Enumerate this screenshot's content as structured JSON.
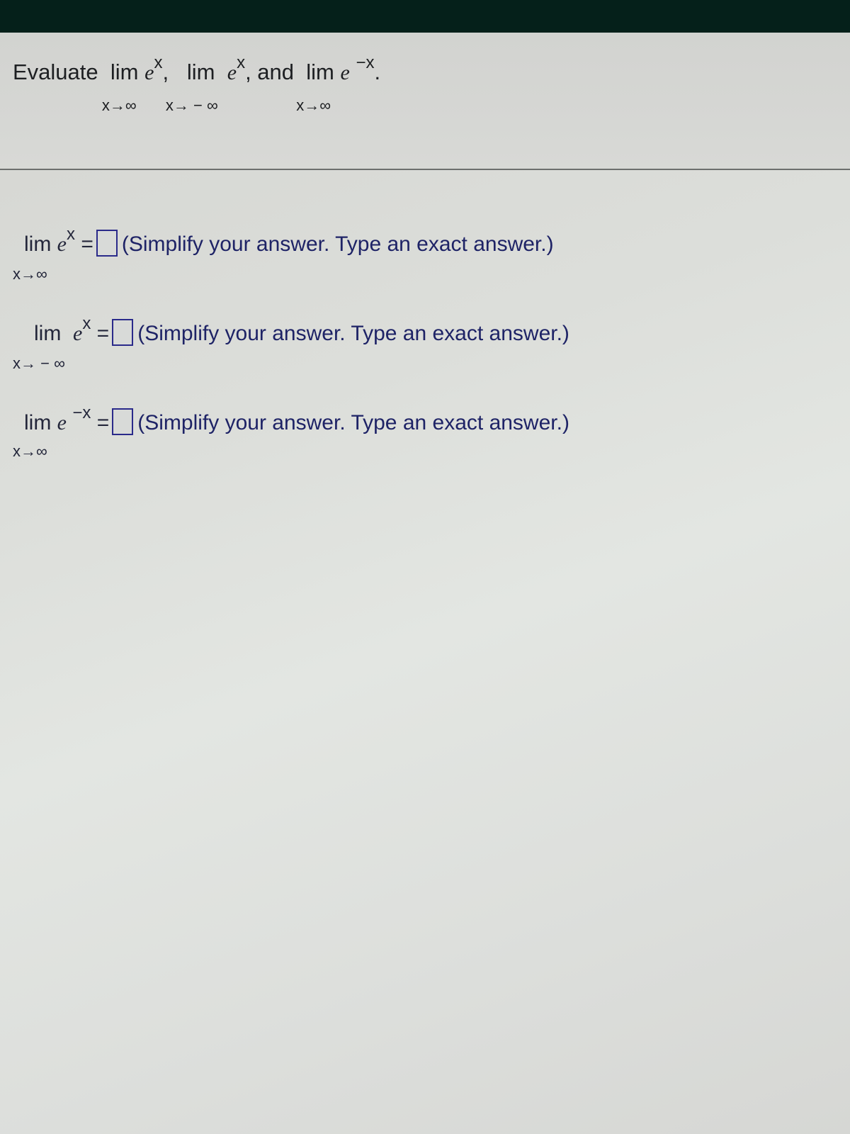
{
  "question": {
    "evaluate_label": "Evaluate",
    "lim_word": "lim",
    "items": [
      {
        "base": "e",
        "exponent": "x",
        "approach": "x→∞",
        "separator": ","
      },
      {
        "base": "e",
        "exponent": "x",
        "approach": "x→ − ∞",
        "separator": ", and"
      },
      {
        "base": "e",
        "exponent": "−x",
        "approach": "x→∞",
        "separator": "."
      }
    ]
  },
  "answers": [
    {
      "lim_word": "lim",
      "base": "e",
      "exponent": "x",
      "approach": "x→∞",
      "equals": "=",
      "value": "",
      "hint": "(Simplify your answer. Type an exact answer.)"
    },
    {
      "lim_word": "lim",
      "base": "e",
      "exponent": "x",
      "approach": "x→ − ∞",
      "equals": "=",
      "value": "",
      "hint": "(Simplify your answer. Type an exact answer.)"
    },
    {
      "lim_word": "lim",
      "base": "e",
      "exponent": "−x",
      "approach": "x→∞",
      "equals": "=",
      "value": "",
      "hint": "(Simplify your answer. Type an exact answer.)"
    }
  ]
}
